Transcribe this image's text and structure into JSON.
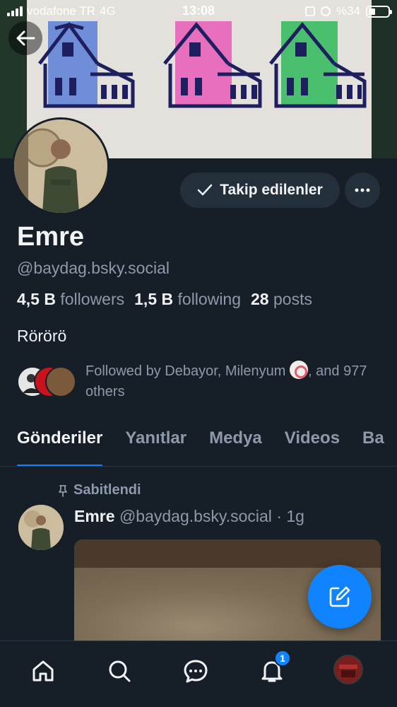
{
  "status_bar": {
    "carrier": "vodafone TR",
    "network": "4G",
    "time": "13:08",
    "battery": "%34",
    "battery_level": 0.34
  },
  "profile": {
    "display_name": "Emre",
    "handle": "@baydag.bsky.social",
    "followers_count": "4,5 B",
    "followers_label": "followers",
    "following_count": "1,5 B",
    "following_label": "following",
    "posts_count": "28",
    "posts_label": "posts",
    "bio": "Rörörö",
    "followed_by_text": "Followed by Debayor, Milenyum",
    "followed_by_suffix": ", and 977 others"
  },
  "actions": {
    "follow_label": "Takip edilenler",
    "more_icon": "ellipsis-icon",
    "back_icon": "arrow-left-icon"
  },
  "tabs": [
    {
      "label": "Gönderiler",
      "active": true
    },
    {
      "label": "Yanıtlar",
      "active": false
    },
    {
      "label": "Medya",
      "active": false
    },
    {
      "label": "Videos",
      "active": false
    },
    {
      "label": "Ba",
      "active": false
    }
  ],
  "post": {
    "pinned_label": "Sabitlendi",
    "author_name": "Emre",
    "author_handle": "@baydag.bsky.social",
    "separator": "·",
    "age": "1g"
  },
  "bottom_nav": {
    "items": [
      "home-icon",
      "search-icon",
      "chat-icon",
      "bell-icon",
      "profile-avatar"
    ],
    "notification_count": "1"
  },
  "colors": {
    "background": "#161e27",
    "accent": "#1083fe",
    "muted_text": "#8d9aab",
    "button_bg": "#232f3b"
  }
}
